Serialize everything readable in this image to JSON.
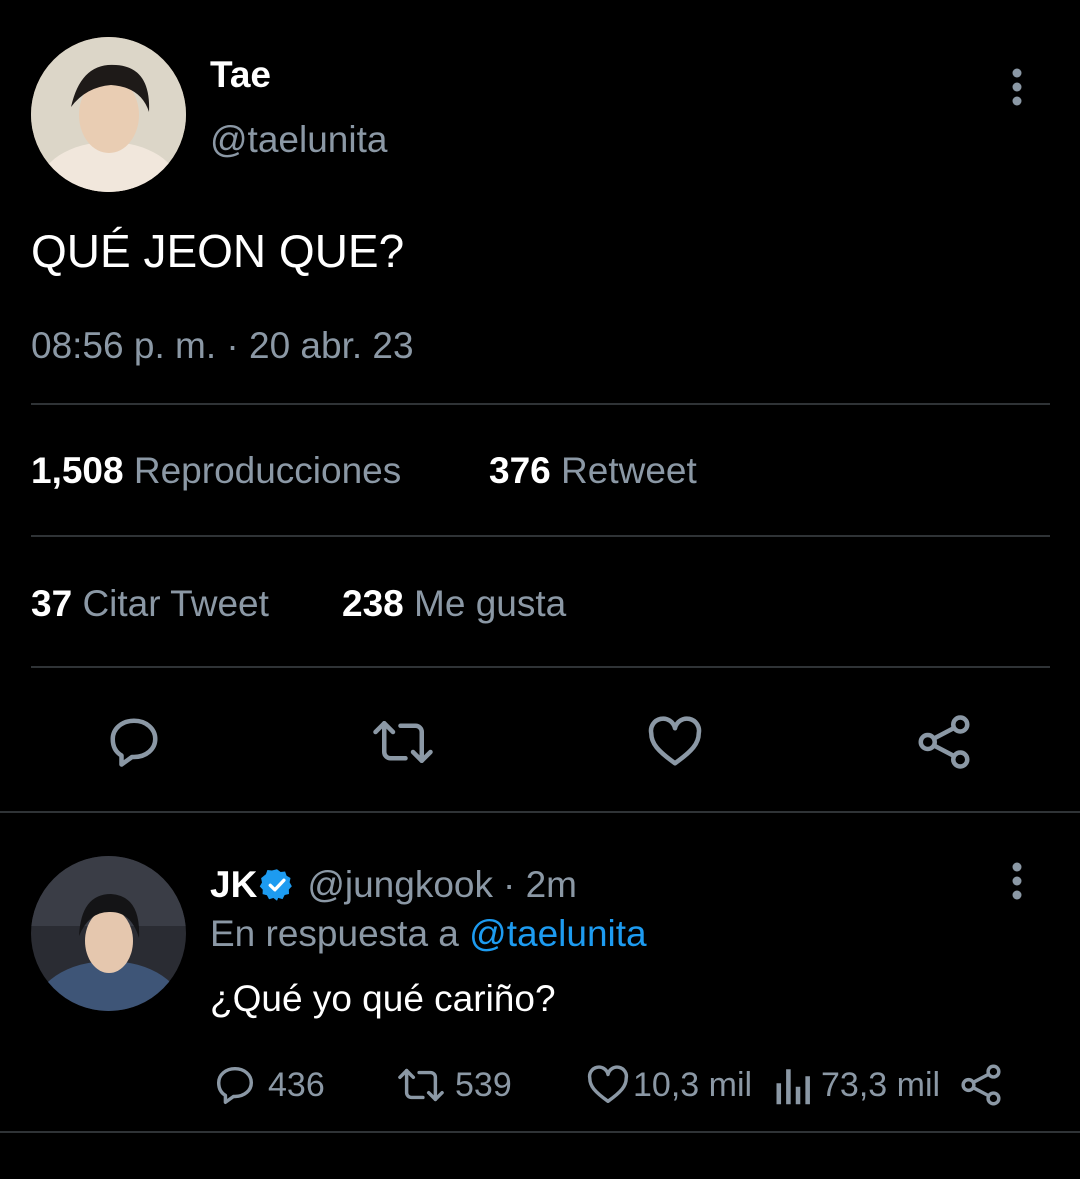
{
  "tweet": {
    "author_name": "Tae",
    "author_handle": "@taelunita",
    "text": "QUÉ JEON QUE?",
    "timestamp": "08:56 p. m. · 20 abr. 23",
    "stats": {
      "views_count": "1,508",
      "views_label": "Reproducciones",
      "retweets_count": "376",
      "retweets_label": "Retweet",
      "quotes_count": "37",
      "quotes_label": "Citar Tweet",
      "likes_count": "238",
      "likes_label": "Me gusta"
    },
    "actions": [
      "reply-icon",
      "retweet-icon",
      "like-icon",
      "share-icon"
    ]
  },
  "reply": {
    "author_name": "JK",
    "verified": true,
    "author_handle": "@jungkook",
    "time": "· 2m",
    "replying_prefix": "En respuesta a",
    "replying_handle": "@taelunita",
    "text": "¿Qué yo qué cariño?",
    "replies": "436",
    "retweets": "539",
    "likes": "10,3 mil",
    "views": "73,3 mil"
  },
  "colors": {
    "background": "#000000",
    "muted": "#8b98a5",
    "link": "#1d9bf0",
    "divider": "#2f3336"
  }
}
